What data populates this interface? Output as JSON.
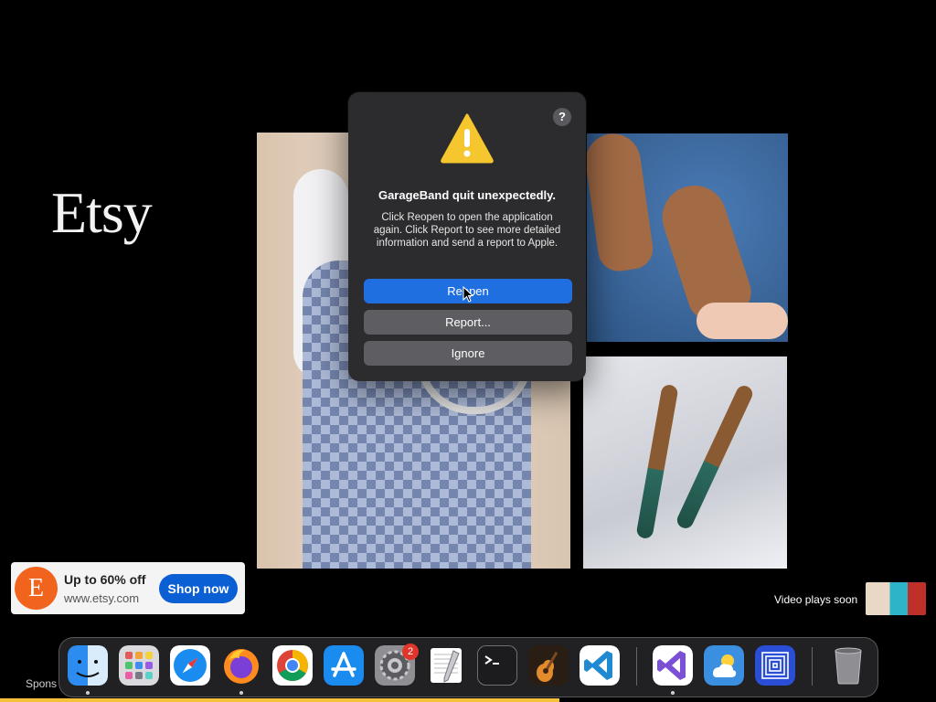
{
  "background_ad": {
    "logo_text": "Etsy",
    "card": {
      "logo_letter": "E",
      "headline": "Up to 60% off",
      "url": "www.etsy.com",
      "cta_label": "Shop now"
    },
    "video_status": "Video plays soon",
    "sponsored_label": "Spons"
  },
  "alert": {
    "help_label": "?",
    "title": "GarageBand quit unexpectedly.",
    "message": "Click Reopen to open the application again. Click Report to see more detailed information and send a report to Apple.",
    "buttons": {
      "reopen": "Reopen",
      "report": "Report...",
      "ignore": "Ignore"
    }
  },
  "dock": {
    "apps": [
      {
        "name": "Finder",
        "icon": "finder-icon",
        "running": true
      },
      {
        "name": "Launchpad",
        "icon": "launchpad-icon",
        "running": false
      },
      {
        "name": "Safari",
        "icon": "safari-icon",
        "running": false
      },
      {
        "name": "Firefox",
        "icon": "firefox-icon",
        "running": true
      },
      {
        "name": "Google Chrome",
        "icon": "chrome-icon",
        "running": false
      },
      {
        "name": "App Store",
        "icon": "app-store-icon",
        "running": false
      },
      {
        "name": "System Settings",
        "icon": "system-settings-icon",
        "running": false,
        "badge": "2"
      },
      {
        "name": "TextEdit",
        "icon": "textedit-icon",
        "running": false
      },
      {
        "name": "Terminal",
        "icon": "terminal-icon",
        "running": false
      },
      {
        "name": "GarageBand",
        "icon": "garageband-icon",
        "running": false
      },
      {
        "name": "Visual Studio Code",
        "icon": "vscode-icon",
        "running": false
      },
      {
        "name": "Visual Studio",
        "icon": "visual-studio-icon",
        "running": true
      },
      {
        "name": "Weather",
        "icon": "weather-icon",
        "running": false
      },
      {
        "name": "Screen App",
        "icon": "concentric-squares-icon",
        "running": false
      },
      {
        "name": "Trash",
        "icon": "trash-icon",
        "running": false
      }
    ]
  },
  "colors": {
    "primary_button": "#1f6fe0",
    "etsy_orange": "#f1641e",
    "cta_blue": "#0b5fd4",
    "badge_red": "#e0352b",
    "progress_yellow": "#f4c13a"
  }
}
